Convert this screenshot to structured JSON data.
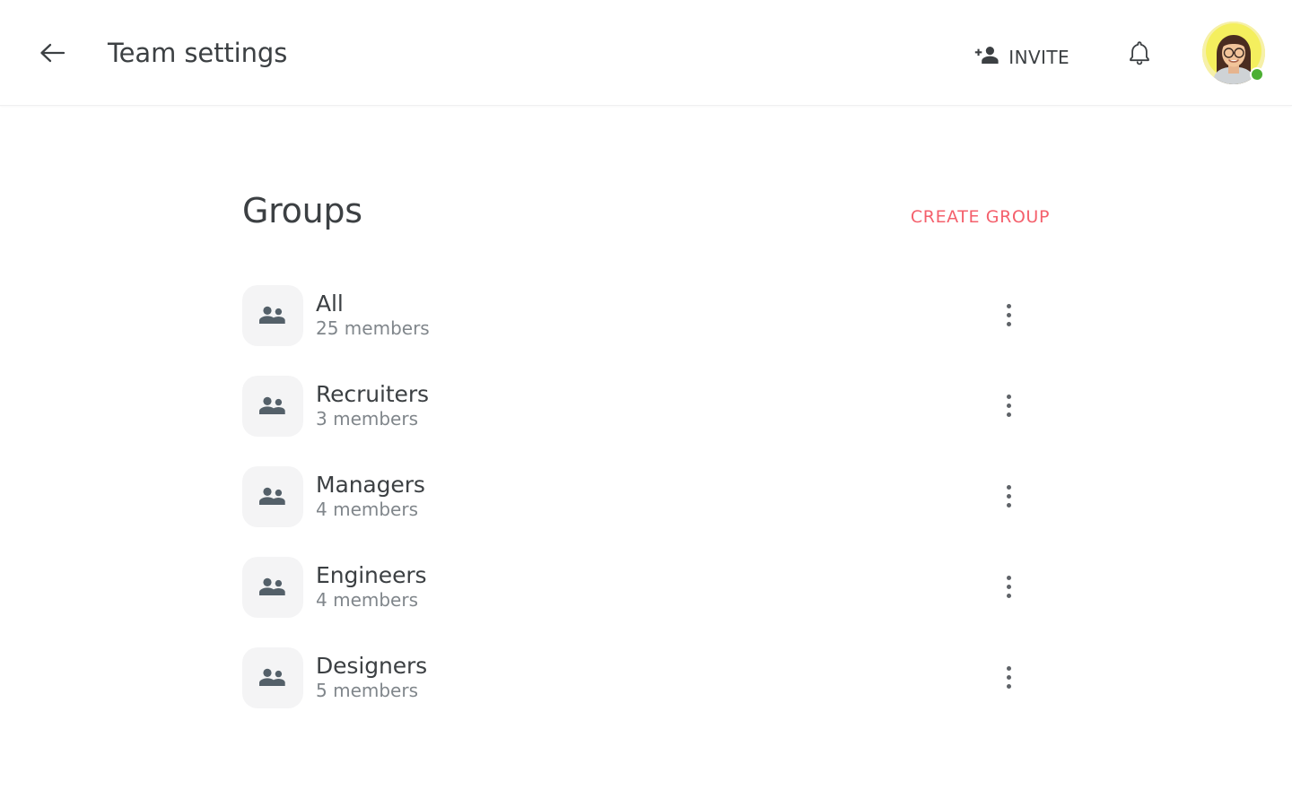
{
  "appbar": {
    "back_icon": "arrow-left-icon",
    "title": "Team settings",
    "invite_label": "INVITE",
    "invite_icon": "person-add-icon",
    "notifications_icon": "bell-icon",
    "avatar_alt": "User avatar",
    "status": "online",
    "colors": {
      "title_text": "#3c4043",
      "status_dot": "#4caf33",
      "avatar_background": "#f4ef6a"
    }
  },
  "main": {
    "section_title": "Groups",
    "create_group_label": "CREATE GROUP",
    "accent_color": "#f4606c",
    "group_icon": "people-icon",
    "row_menu_icon": "more-vertical-icon",
    "groups": [
      {
        "name": "All",
        "members": "25 members"
      },
      {
        "name": "Recruiters",
        "members": "3 members"
      },
      {
        "name": "Managers",
        "members": "4 members"
      },
      {
        "name": "Engineers",
        "members": "4 members"
      },
      {
        "name": "Designers",
        "members": "5 members"
      }
    ]
  }
}
